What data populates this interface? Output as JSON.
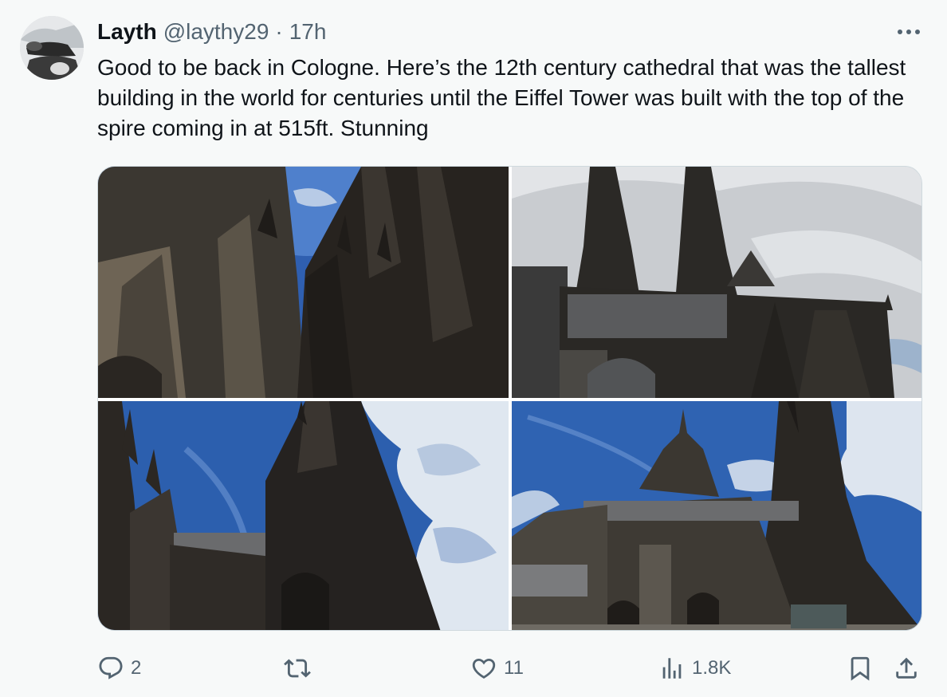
{
  "tweet": {
    "author_name": "Layth",
    "handle": "@laythy29",
    "separator": "·",
    "time": "17h",
    "text": "Good to be back in Cologne. Here’s the 12th century cathedral that was the tallest building in the world for centuries until the Eiffel Tower was built with the top of the spire coming in at 515ft. Stunning"
  },
  "icons": {
    "more": "more-horizontal-icon",
    "reply": "reply-icon",
    "retweet": "retweet-icon",
    "like": "heart-icon",
    "views": "views-chart-icon",
    "bookmark": "bookmark-icon",
    "share": "share-icon"
  },
  "actions": {
    "replies": "2",
    "likes": "11",
    "views": "1.8K"
  },
  "colors": {
    "text": "#0f1419",
    "secondary": "#536471",
    "background": "#f7f9f9",
    "border": "#cfd9de"
  }
}
